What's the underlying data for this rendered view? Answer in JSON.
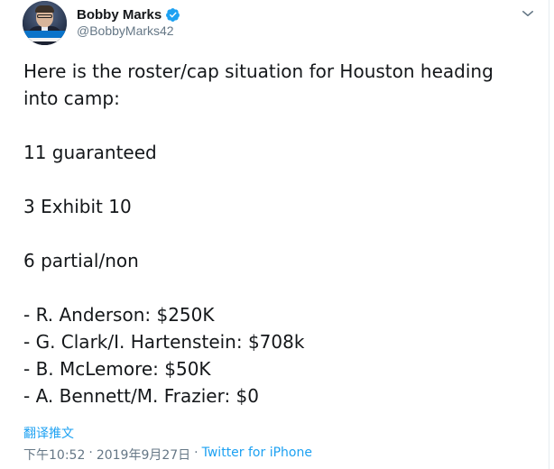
{
  "author": {
    "display_name": "Bobby Marks",
    "handle": "@BobbyMarks42",
    "verified": true,
    "avatar_icon": "profile-photo"
  },
  "tweet": {
    "lines": [
      "Here is the roster/cap situation for Houston heading",
      "into camp:",
      "",
      "11 guaranteed",
      "",
      "3 Exhibit 10",
      "",
      "6 partial/non",
      "",
      "- R. Anderson: $250K",
      "- G. Clark/I. Hartenstein: $708k",
      "- B. McLemore: $50K",
      "- A. Bennett/M. Frazier: $0"
    ]
  },
  "actions": {
    "translate_label": "翻译推文",
    "more_icon": "chevron-down-icon"
  },
  "meta": {
    "time": "下午10:52",
    "separator_1": "·",
    "date": "2019年9月27日",
    "separator_2": "·",
    "source": "Twitter for iPhone"
  },
  "colors": {
    "link": "#1da1f2",
    "muted": "#657786",
    "text": "#14171a",
    "verified": "#1da1f2"
  }
}
